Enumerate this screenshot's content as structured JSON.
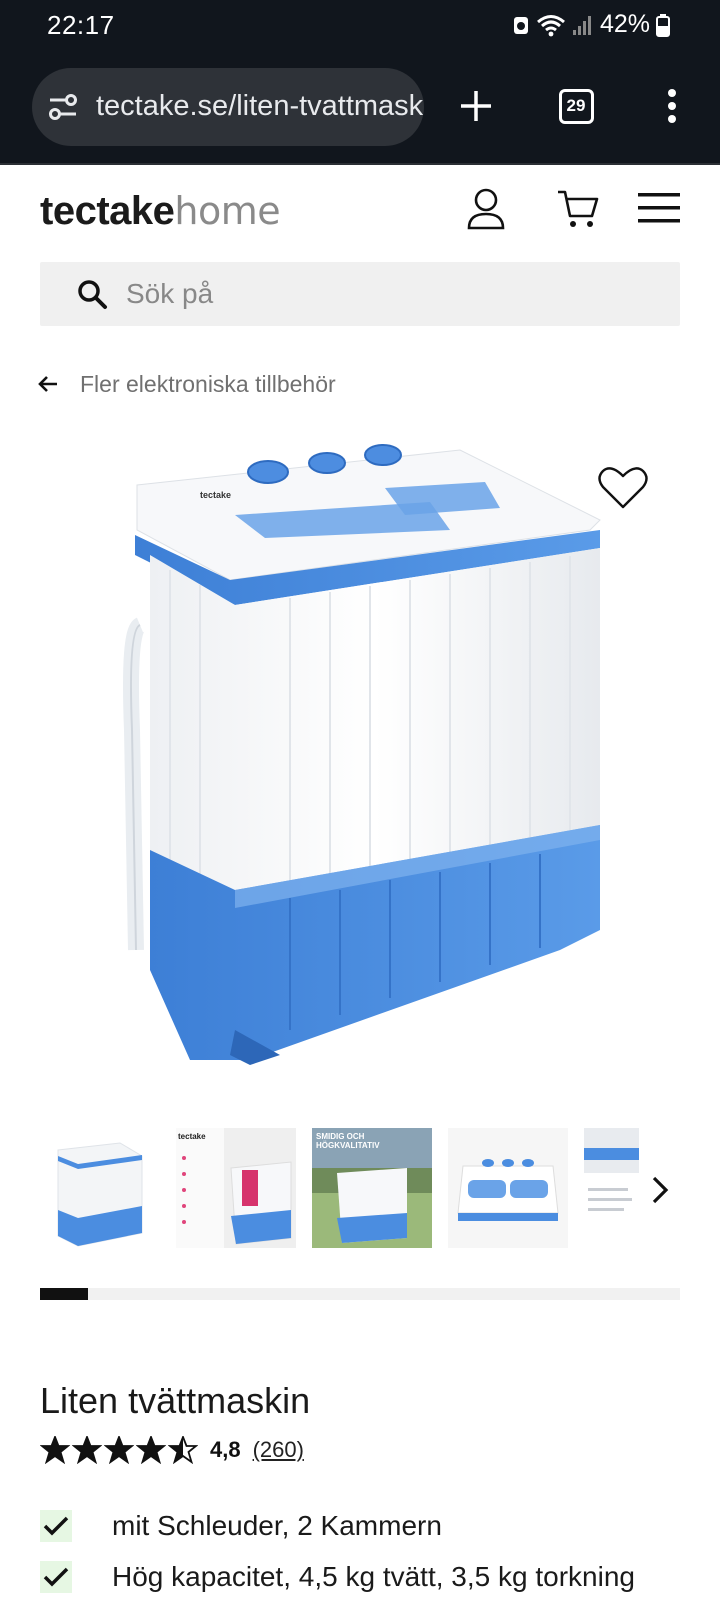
{
  "status_bar": {
    "time": "22:17",
    "battery": "42%"
  },
  "browser": {
    "url": "tectake.se/liten-tvattmaskin",
    "tab_count": "29"
  },
  "site": {
    "logo_bold": "tectake",
    "logo_light": "home"
  },
  "search": {
    "placeholder": "Sök på"
  },
  "breadcrumb": {
    "label": "Fler elektroniska tillbehör"
  },
  "gallery": {
    "thumbnails": [
      {
        "caption": ""
      },
      {
        "caption": "tectake"
      },
      {
        "caption": "SMIDIG OCH HÖGKVALITATIV"
      },
      {
        "caption": ""
      },
      {
        "caption": ""
      }
    ],
    "progress": 0.075
  },
  "product": {
    "title": "Liten tvättmaskin",
    "rating_value": "4,8",
    "review_count": "(260)",
    "stars": 4.5,
    "features": [
      "mit Schleuder, 2 Kammern",
      "Hög kapacitet, 4,5 kg tvätt, 3,5 kg torkning"
    ]
  },
  "colors": {
    "accent_blue": "#4a8fe0",
    "check_bg": "#e6f7e3"
  }
}
